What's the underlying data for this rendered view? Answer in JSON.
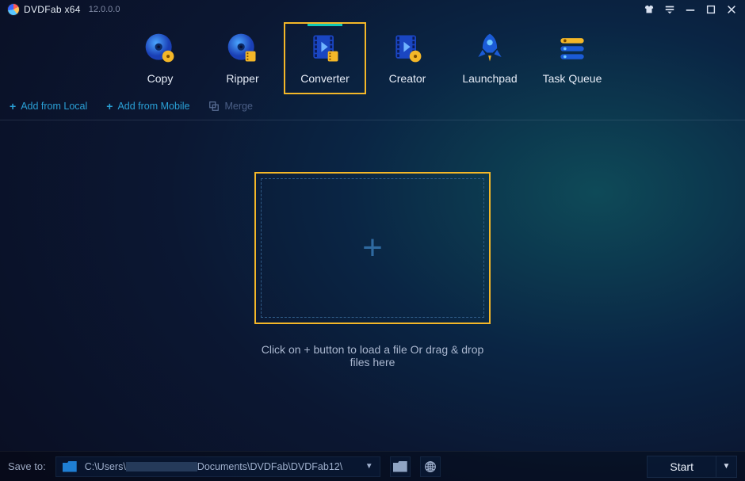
{
  "titlebar": {
    "app_name": "DVDFab x64",
    "version": "12.0.0.0"
  },
  "nav": {
    "items": [
      {
        "label": "Copy",
        "icon": "disc-copy-icon",
        "active": false
      },
      {
        "label": "Ripper",
        "icon": "disc-ripper-icon",
        "active": false
      },
      {
        "label": "Converter",
        "icon": "film-convert-icon",
        "active": true
      },
      {
        "label": "Creator",
        "icon": "film-create-icon",
        "active": false
      },
      {
        "label": "Launchpad",
        "icon": "rocket-icon",
        "active": false
      },
      {
        "label": "Task Queue",
        "icon": "queue-icon",
        "active": false
      }
    ]
  },
  "subbar": {
    "add_local": "Add from Local",
    "add_mobile": "Add from Mobile",
    "merge": "Merge"
  },
  "dropzone": {
    "hint": "Click on + button to load a file Or drag & drop files here"
  },
  "footer": {
    "save_to_label": "Save to:",
    "path_prefix": "C:\\Users\\",
    "path_suffix": "Documents\\DVDFab\\DVDFab12\\",
    "start_label": "Start"
  }
}
